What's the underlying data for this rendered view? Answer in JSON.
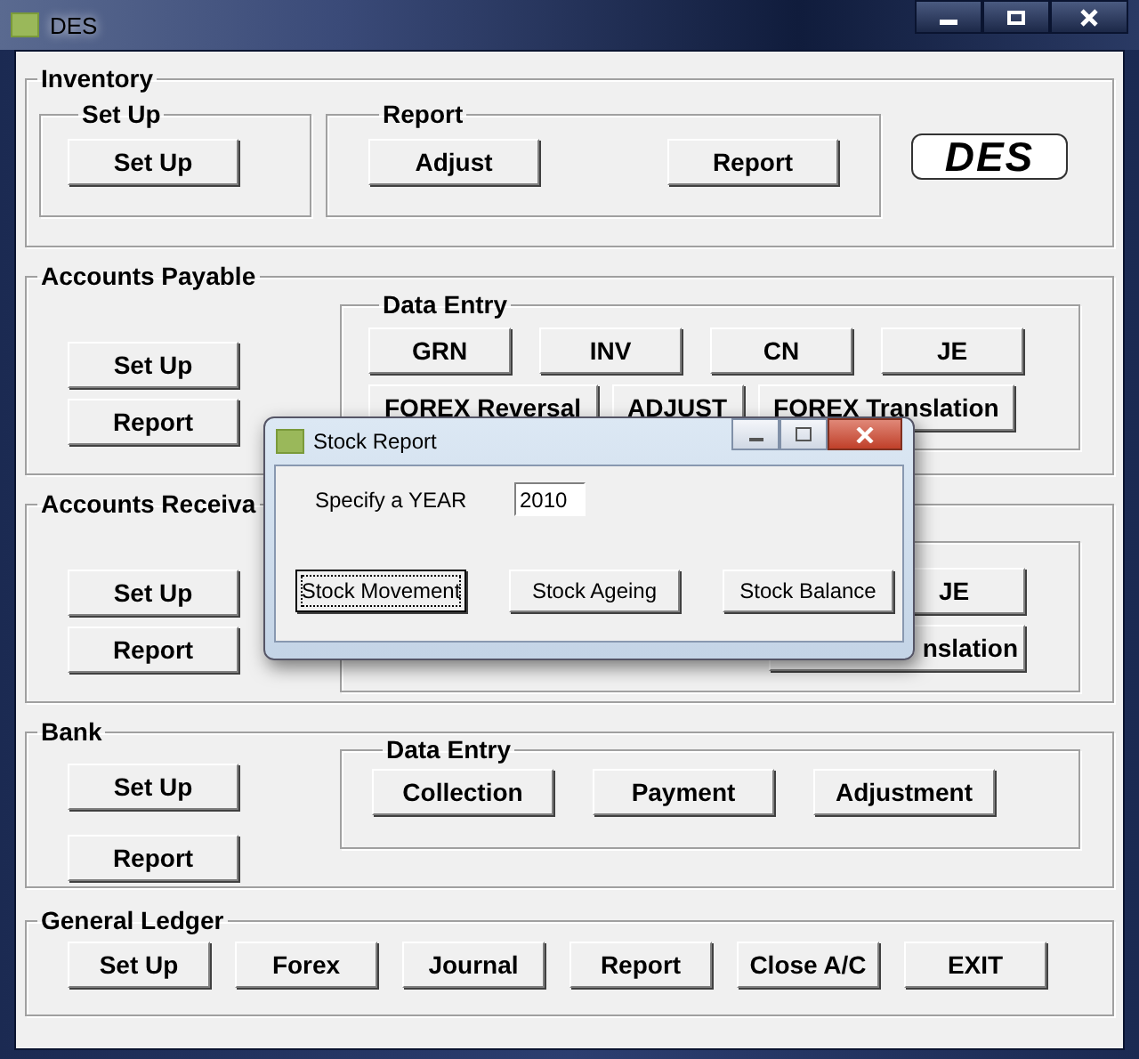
{
  "window": {
    "title": "DES"
  },
  "inventory": {
    "title": "Inventory",
    "setup": {
      "title": "Set Up",
      "buttons": [
        "Set Up"
      ]
    },
    "report": {
      "title": "Report",
      "buttons": [
        "Adjust",
        "Report"
      ]
    },
    "logo": "DES"
  },
  "accounts_payable": {
    "title": "Accounts Payable",
    "buttons": [
      "Set Up",
      "Report"
    ],
    "data_entry": {
      "title": "Data Entry",
      "rows": [
        [
          "GRN",
          "INV",
          "CN",
          "JE"
        ],
        [
          "FOREX Reversal",
          "ADJUST",
          "FOREX Translation"
        ]
      ]
    }
  },
  "accounts_receivable": {
    "title": "Accounts Receiva",
    "buttons": [
      "Set Up",
      "Report"
    ],
    "data_entry": {
      "rows": [
        [
          "JE"
        ],
        [
          "nslation"
        ]
      ]
    }
  },
  "bank": {
    "title": "Bank",
    "buttons": [
      "Set Up",
      "Report"
    ],
    "data_entry": {
      "title": "Data Entry",
      "buttons": [
        "Collection",
        "Payment",
        "Adjustment"
      ]
    }
  },
  "general_ledger": {
    "title": "General Ledger",
    "buttons": [
      "Set Up",
      "Forex",
      "Journal",
      "Report",
      "Close A/C",
      "EXIT"
    ]
  },
  "dialog": {
    "title": "Stock Report",
    "year_label": "Specify a YEAR",
    "year_value": "2010",
    "buttons": [
      {
        "label": "Stock Movement",
        "focused": true
      },
      {
        "label": "Stock Ageing",
        "focused": false
      },
      {
        "label": "Stock Balance",
        "focused": false
      }
    ]
  }
}
